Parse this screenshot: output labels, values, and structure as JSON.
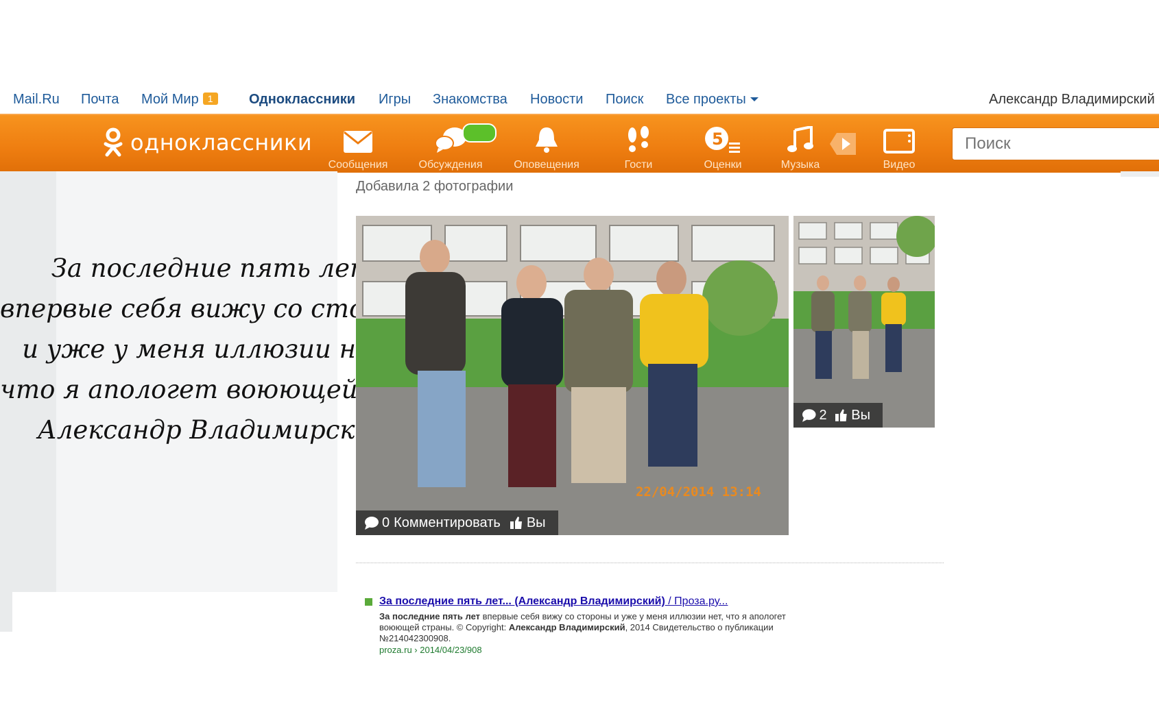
{
  "portal": {
    "links": [
      "Mail.Ru",
      "Почта",
      "Мой Мир",
      "Одноклассники",
      "Игры",
      "Знакомства",
      "Новости",
      "Поиск",
      "Все проекты"
    ],
    "moimir_badge": "1",
    "user_name": "Александр Владимирский"
  },
  "toolbar": {
    "logo_text": "одноклассники",
    "items": [
      "Сообщения",
      "Обсуждения",
      "Оповещения",
      "Гости",
      "Оценки",
      "Музыка",
      "Видео"
    ],
    "search_placeholder": "Поиск"
  },
  "overlay_poem": [
    "За последние пять лет",
    "впервые себя вижу со стороны",
    "и уже у меня иллюзии нет,",
    "что я апологет воюющей страны.",
    "Александр Владимирский"
  ],
  "feed": {
    "title": "Добавила 2 фотографии",
    "main_photo": {
      "comments": "0",
      "comment_label": "Комментировать",
      "like_label": "Вы",
      "stamp": "22/04/2014 13:14"
    },
    "side_photo": {
      "comments": "2",
      "like_label": "Вы"
    }
  },
  "snippet": {
    "title_main": "За последние пять лет",
    "title_rest": "... (Александр Владимирский)",
    "title_site": " / Проза.ру...",
    "body_bold": "За последние пять лет",
    "body_text": " впервые себя вижу со стороны и уже у меня иллюзии нет, что я апологет воюющей страны. © Copyright: ",
    "body_author": "Александр Владимирский",
    "body_tail": ", 2014 Свидетельство о публикации №214042300908.",
    "url": "proza.ru › 2014/04/23/908"
  },
  "colors": {
    "ok_orange": "#f7931e",
    "link_blue": "#1f5b9a",
    "snippet_green": "#1e7a2e"
  }
}
